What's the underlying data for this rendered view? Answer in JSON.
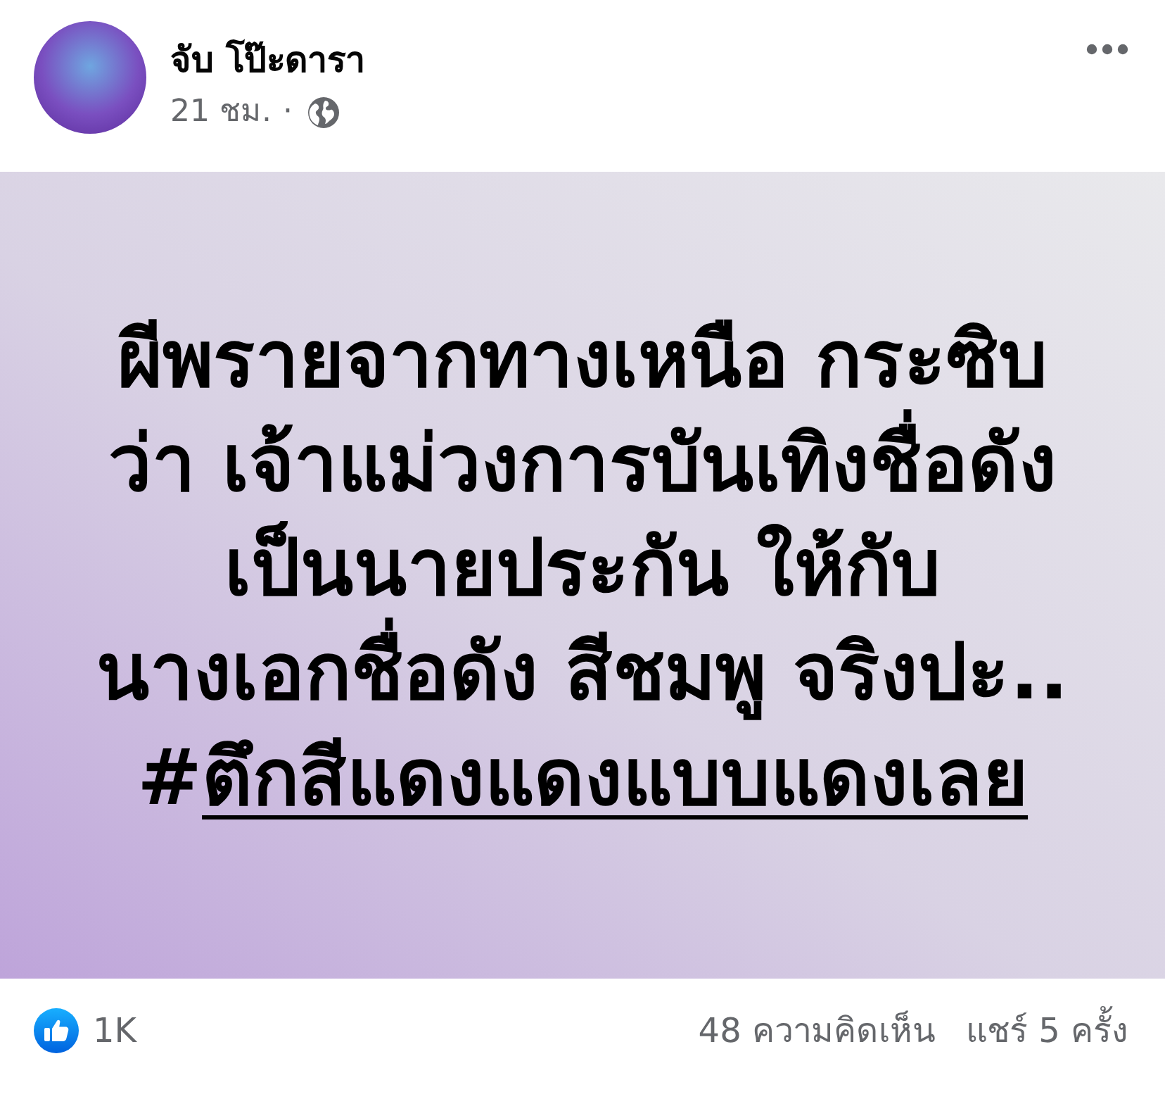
{
  "header": {
    "author": "จับ โป๊ะดารา",
    "time": "21 ชม.",
    "separator": "·"
  },
  "post": {
    "lines": [
      "ผีพรายจากทางเหนือ กระซิบ",
      "ว่า เจ้าแม่วงการบันเทิงชื่อดัง",
      "เป็นนายประกัน ให้กับ",
      "นางเอกชื่อดัง สีชมพู จริงปะ.."
    ],
    "hashtag": {
      "symbol": "#",
      "tag": "ตึกสีแดงแดงแบบแดงเลย"
    }
  },
  "footer": {
    "reactions": "1K",
    "comments": "48 ความคิดเห็น",
    "shares": "แชร์ 5 ครั้ง"
  }
}
